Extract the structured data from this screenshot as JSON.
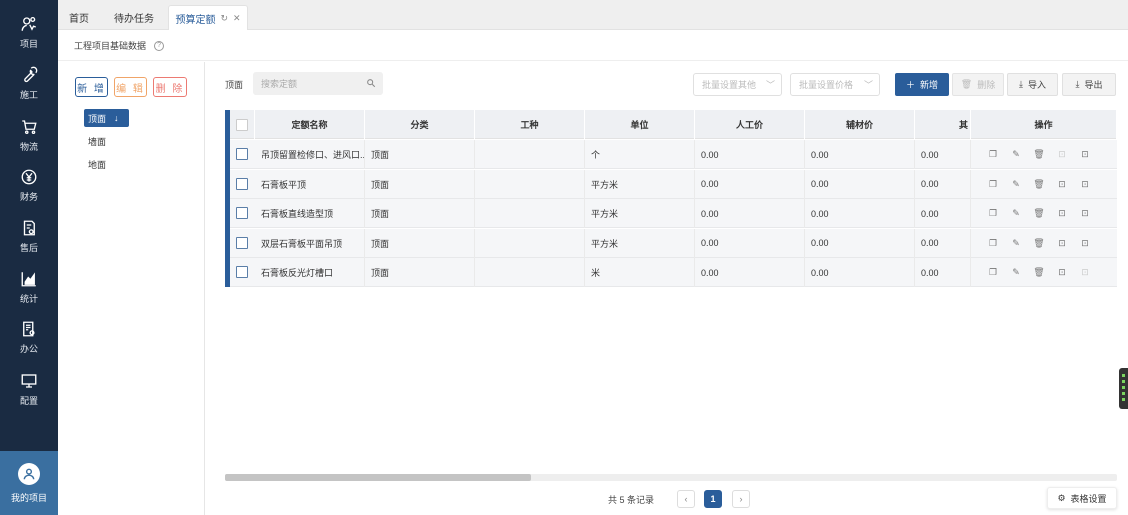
{
  "sidebar": {
    "items": [
      {
        "label": "项目",
        "icon": "project-icon"
      },
      {
        "label": "施工",
        "icon": "wrench-icon"
      },
      {
        "label": "物流",
        "icon": "cart-icon"
      },
      {
        "label": "财务",
        "icon": "yen-icon"
      },
      {
        "label": "售后",
        "icon": "service-icon"
      },
      {
        "label": "统计",
        "icon": "chart-icon"
      },
      {
        "label": "办公",
        "icon": "office-icon"
      },
      {
        "label": "配置",
        "icon": "monitor-icon"
      }
    ],
    "my_project": "我的项目"
  },
  "tabs": [
    {
      "label": "首页"
    },
    {
      "label": "待办任务"
    },
    {
      "label": "预算定额",
      "active": true
    }
  ],
  "header": {
    "breadcrumb": "工程项目基础数据"
  },
  "tree": {
    "buttons": {
      "add": "新 增",
      "edit": "编 辑",
      "delete": "删 除"
    },
    "items": [
      {
        "label": "顶面",
        "selected": true
      },
      {
        "label": "墙面"
      },
      {
        "label": "地面"
      }
    ],
    "sort_arrow": "↓"
  },
  "toolbar": {
    "filter_label": "顶面",
    "search_placeholder": "搜索定额",
    "batch_other": "批量设置其他",
    "batch_price": "批量设置价格",
    "add": "新增",
    "delete": "删除",
    "import": "导入",
    "export": "导出"
  },
  "table": {
    "columns": [
      "定额名称",
      "分类",
      "工种",
      "单位",
      "人工价",
      "辅材价",
      "其",
      "操作"
    ],
    "rows": [
      {
        "name": "吊顶留置检修口、进风口...",
        "category": "顶面",
        "trade": "",
        "unit": "个",
        "labor": "0.00",
        "material": "0.00",
        "other": "0.00"
      },
      {
        "name": "石膏板平顶",
        "category": "顶面",
        "trade": "",
        "unit": "平方米",
        "labor": "0.00",
        "material": "0.00",
        "other": "0.00"
      },
      {
        "name": "石膏板直线造型顶",
        "category": "顶面",
        "trade": "",
        "unit": "平方米",
        "labor": "0.00",
        "material": "0.00",
        "other": "0.00"
      },
      {
        "name": "双层石膏板平面吊顶",
        "category": "顶面",
        "trade": "",
        "unit": "平方米",
        "labor": "0.00",
        "material": "0.00",
        "other": "0.00"
      },
      {
        "name": "石膏板反光灯槽口",
        "category": "顶面",
        "trade": "",
        "unit": "米",
        "labor": "0.00",
        "material": "0.00",
        "other": "0.00"
      }
    ]
  },
  "pagination": {
    "total": "共 5 条记录",
    "current": "1",
    "prev": "‹",
    "next": "›"
  },
  "table_settings": "表格设置",
  "colors": {
    "sidebar": "#1a2b42",
    "accent": "#2a5d9a",
    "my_project_bg": "#3a6fa0",
    "add_border": "#2a5d9a",
    "edit_border": "#f0a468",
    "delete_border": "#ec7a72"
  }
}
